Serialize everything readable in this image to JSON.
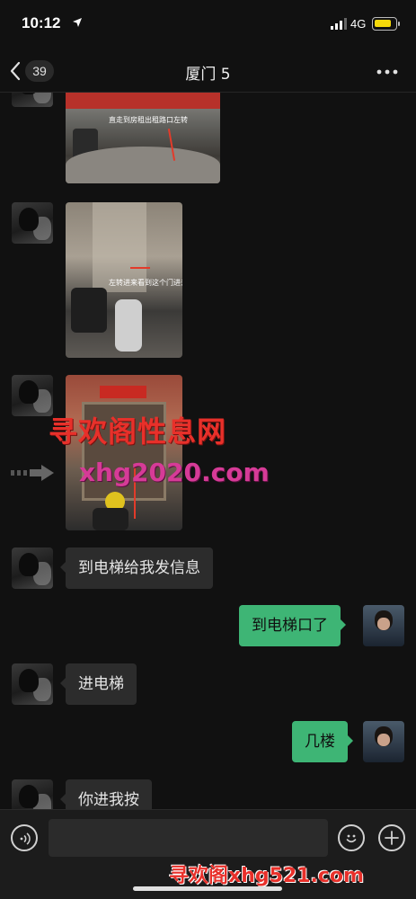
{
  "status_bar": {
    "time": "10:12",
    "network": "4G",
    "battery_level": 0.85
  },
  "nav": {
    "unread_count": "39",
    "title": "厦门 5"
  },
  "messages": {
    "photo1_caption": "直走到房租出租路口左转",
    "photo2_caption": "左转进来看到这个门进去",
    "m1": "到电梯给我发信息",
    "m2": "到电梯口了",
    "m3": "进电梯",
    "m4": "几楼",
    "m5": "你进我按"
  },
  "watermark": {
    "line1": "寻欢阁性息网",
    "line2": "xhg2020.com",
    "bottom": "寻欢阁xhg521.com"
  },
  "input": {
    "value": ""
  },
  "colors": {
    "sent_bubble": "#3eb575",
    "received_bubble": "#2c2c2c",
    "background": "#111111",
    "watermark": "#e8302a"
  }
}
